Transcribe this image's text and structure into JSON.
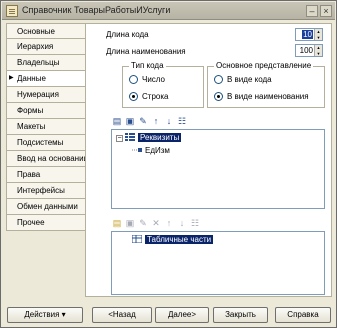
{
  "window": {
    "title": "Справочник ТоварыРаботыИУслуги"
  },
  "tabs": [
    {
      "label": "Основные",
      "active": false
    },
    {
      "label": "Иерархия",
      "active": false
    },
    {
      "label": "Владельцы",
      "active": false
    },
    {
      "label": "Данные",
      "active": true
    },
    {
      "label": "Нумерация",
      "active": false
    },
    {
      "label": "Формы",
      "active": false
    },
    {
      "label": "Макеты",
      "active": false
    },
    {
      "label": "Подсистемы",
      "active": false
    },
    {
      "label": "Ввод на основании",
      "active": false
    },
    {
      "label": "Права",
      "active": false
    },
    {
      "label": "Интерфейсы",
      "active": false
    },
    {
      "label": "Обмен данными",
      "active": false
    },
    {
      "label": "Прочее",
      "active": false
    }
  ],
  "fields": {
    "code_length_label": "Длина кода",
    "code_length_value": "10",
    "name_length_label": "Длина наименования",
    "name_length_value": "100"
  },
  "code_type": {
    "title": "Тип кода",
    "options": [
      {
        "label": "Число",
        "selected": false
      },
      {
        "label": "Строка",
        "selected": true
      }
    ]
  },
  "main_presentation": {
    "title": "Основное представление",
    "options": [
      {
        "label": "В виде кода",
        "selected": false
      },
      {
        "label": "В виде наименования",
        "selected": true
      }
    ]
  },
  "attributes_tree": {
    "root": "Реквизиты",
    "child": "ЕдИзм"
  },
  "tabular_tree": {
    "root": "Табличные части"
  },
  "buttons": {
    "actions": "Действия",
    "back": "<Назад",
    "next": "Далее>",
    "close": "Закрыть",
    "help": "Справка"
  }
}
